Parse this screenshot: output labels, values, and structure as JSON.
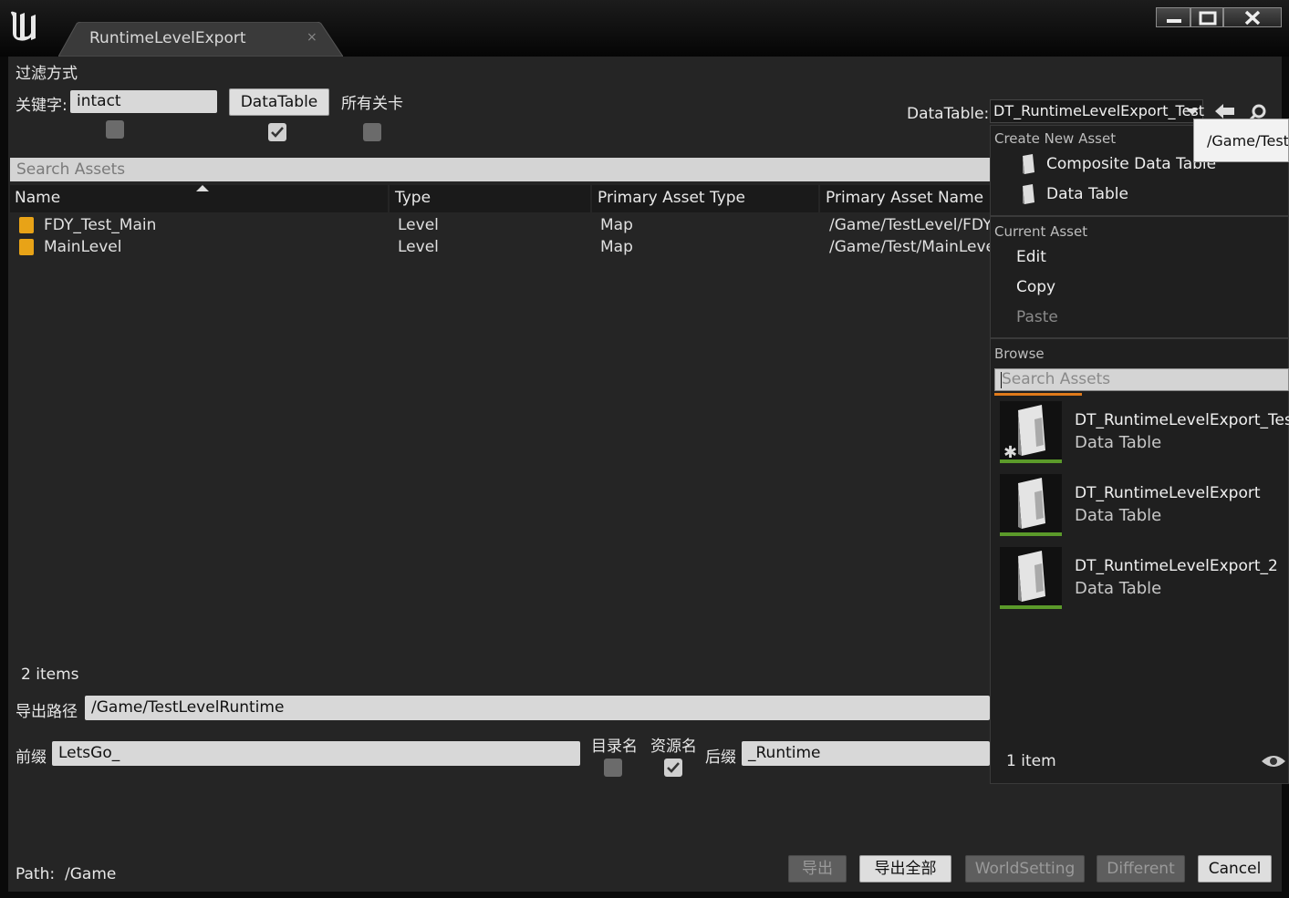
{
  "window": {
    "tab_title": "RuntimeLevelExport",
    "tab_close": "×"
  },
  "filter": {
    "heading": "过滤方式",
    "keyword_label": "关键字:",
    "keyword_value": "intact",
    "datatable_button": "DataTable",
    "all_levels_label": "所有关卡",
    "checkbox_keyword": false,
    "checkbox_datatable": true,
    "checkbox_all_levels": false
  },
  "datatable_picker": {
    "label": "DataTable:",
    "value": "DT_RuntimeLevelExport_Test"
  },
  "asset_list": {
    "search_placeholder": "Search Assets",
    "columns": [
      "Name",
      "Type",
      "Primary Asset Type",
      "Primary Asset Name"
    ],
    "rows": [
      {
        "name": "FDY_Test_Main",
        "type": "Level",
        "primary_type": "Map",
        "primary_name": "/Game/TestLevel/FDY"
      },
      {
        "name": "MainLevel",
        "type": "Level",
        "primary_type": "Map",
        "primary_name": "/Game/Test/MainLeve"
      }
    ],
    "count": "2 items"
  },
  "export": {
    "path_label": "导出路径",
    "path_value": "/Game/TestLevelRuntime",
    "prefix_label": "前缀",
    "prefix_value": "LetsGo_",
    "dirname_label": "目录名",
    "dirname_checked": false,
    "assetname_label": "资源名",
    "assetname_checked": true,
    "suffix_label": "后缀",
    "suffix_value": "_Runtime"
  },
  "footer": {
    "path_label": "Path:",
    "path_value": "/Game",
    "buttons": [
      "导出",
      "导出全部",
      "WorldSetting",
      "Different",
      "Cancel"
    ]
  },
  "dropdown": {
    "create_new_header": "Create New Asset",
    "create_items": [
      "Composite Data Table",
      "Data Table"
    ],
    "current_header": "Current Asset",
    "current_items": [
      "Edit",
      "Copy",
      "Paste"
    ],
    "browse_header": "Browse",
    "search_placeholder": "Search Assets",
    "assets": [
      {
        "name": "DT_RuntimeLevelExport_Test",
        "type": "Data Table"
      },
      {
        "name": "DT_RuntimeLevelExport",
        "type": "Data Table"
      },
      {
        "name": "DT_RuntimeLevelExport_2",
        "type": "Data Table"
      }
    ],
    "count": "1 item",
    "tooltip": "/Game/TestL"
  },
  "colors": {
    "panel": "#252525",
    "titlebar": "#0a0a0a",
    "level_icon": "#e8a317",
    "asset_bar": "#5b9a2a",
    "search_underline": "#e07a1a"
  },
  "icons": [
    "unreal-logo-icon",
    "minimize-icon",
    "maximize-icon",
    "close-icon",
    "sort-up-icon",
    "level-icon",
    "back-arrow-icon",
    "search-icon",
    "datatable-icon",
    "eye-icon",
    "checkmark-icon",
    "caret-down-icon"
  ]
}
